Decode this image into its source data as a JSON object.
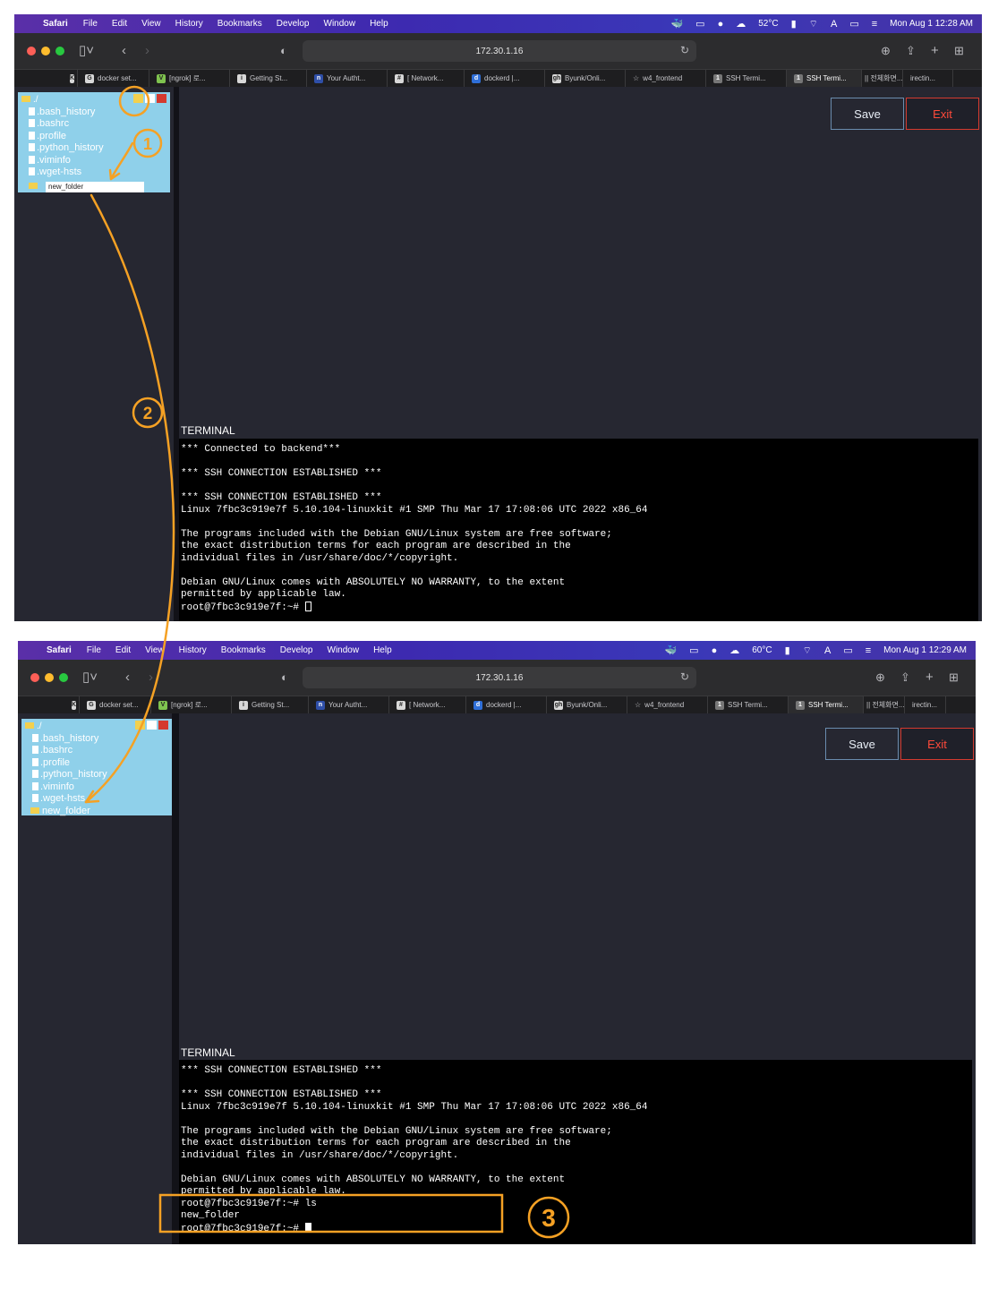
{
  "menubar": {
    "app": "Safari",
    "items": [
      "File",
      "Edit",
      "View",
      "History",
      "Bookmarks",
      "Develop",
      "Window",
      "Help"
    ],
    "status": [
      "52°C",
      "Mon Aug 1  12:28 AM"
    ],
    "status2": [
      "60°C",
      "Mon Aug 1  12:29 AM"
    ]
  },
  "browser": {
    "url": "172.30.1.16",
    "tabs": [
      {
        "icon": "K",
        "label": "K"
      },
      {
        "icon": "G",
        "label": "docker set..."
      },
      {
        "icon": "V",
        "label": "[ngrok] 로..."
      },
      {
        "icon": "i",
        "label": "Getting St..."
      },
      {
        "icon": "n",
        "label": "Your Autht..."
      },
      {
        "icon": "#",
        "label": "[ Network..."
      },
      {
        "icon": "d",
        "label": "dockerd |..."
      },
      {
        "icon": "gh",
        "label": "Byunk/Onli..."
      },
      {
        "icon": "☆",
        "label": "w4_frontend"
      },
      {
        "icon": "1",
        "label": "SSH Termi..."
      },
      {
        "icon": "1",
        "label": "SSH Termi..."
      },
      {
        "icon": "",
        "label": "|| 전체화면..."
      },
      {
        "icon": "",
        "label": "irectin..."
      }
    ],
    "active_tab_index": 10
  },
  "file_tree": {
    "root": "./",
    "files": [
      ".bash_history",
      ".bashrc",
      ".profile",
      ".python_history",
      ".viminfo",
      ".wget-hsts"
    ],
    "new_folder_input": "new_folder",
    "new_folder": "new_folder"
  },
  "editor": {
    "save_label": "Save",
    "exit_label": "Exit"
  },
  "terminal": {
    "label": "TERMINAL",
    "lines_before": [
      "*** Connected to backend***",
      "",
      "*** SSH CONNECTION ESTABLISHED ***",
      "",
      "*** SSH CONNECTION ESTABLISHED ***",
      "Linux 7fbc3c919e7f 5.10.104-linuxkit #1 SMP Thu Mar 17 17:08:06 UTC 2022 x86_64",
      "",
      "The programs included with the Debian GNU/Linux system are free software;",
      "the exact distribution terms for each program are described in the",
      "individual files in /usr/share/doc/*/copyright.",
      "",
      "Debian GNU/Linux comes with ABSOLUTELY NO WARRANTY, to the extent",
      "permitted by applicable law.",
      "root@7fbc3c919e7f:~# "
    ],
    "lines_after": [
      "*** SSH CONNECTION ESTABLISHED ***",
      "",
      "*** SSH CONNECTION ESTABLISHED ***",
      "Linux 7fbc3c919e7f 5.10.104-linuxkit #1 SMP Thu Mar 17 17:08:06 UTC 2022 x86_64",
      "",
      "The programs included with the Debian GNU/Linux system are free software;",
      "the exact distribution terms for each program are described in the",
      "individual files in /usr/share/doc/*/copyright.",
      "",
      "Debian GNU/Linux comes with ABSOLUTELY NO WARRANTY, to the extent",
      "permitted by applicable law.",
      "root@7fbc3c919e7f:~# ls",
      "new_folder",
      "root@7fbc3c919e7f:~# "
    ]
  },
  "annotations": {
    "color": "#f5a124",
    "steps": [
      "1",
      "2",
      "3"
    ]
  }
}
